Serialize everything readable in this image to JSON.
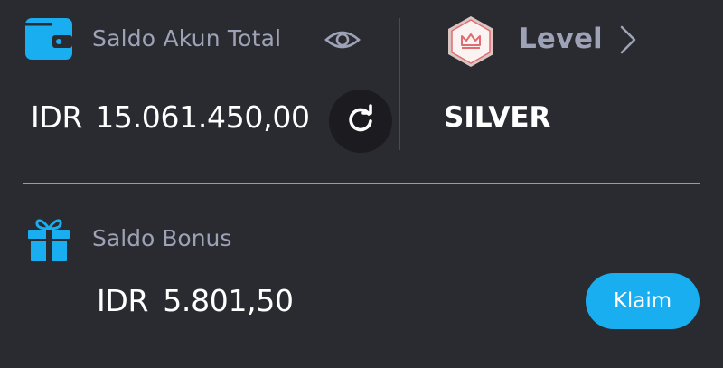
{
  "total_balance": {
    "label": "Saldo Akun Total",
    "currency": "IDR",
    "amount": "15.061.450,00",
    "icons": {
      "wallet": "wallet-icon",
      "visibility": "eye-icon",
      "refresh": "refresh-icon"
    }
  },
  "level": {
    "label": "Level",
    "value": "SILVER",
    "icons": {
      "badge": "crown-badge-icon",
      "navigate": "chevron-right-icon"
    }
  },
  "bonus": {
    "label": "Saldo Bonus",
    "currency": "IDR",
    "amount": "5.801,50",
    "claim_label": "Klaim",
    "icons": {
      "gift": "gift-icon"
    }
  },
  "colors": {
    "background": "#2a2a31",
    "accent": "#18aef0",
    "muted_text": "#9ea2b6",
    "badge_pink": "#e06c72"
  }
}
